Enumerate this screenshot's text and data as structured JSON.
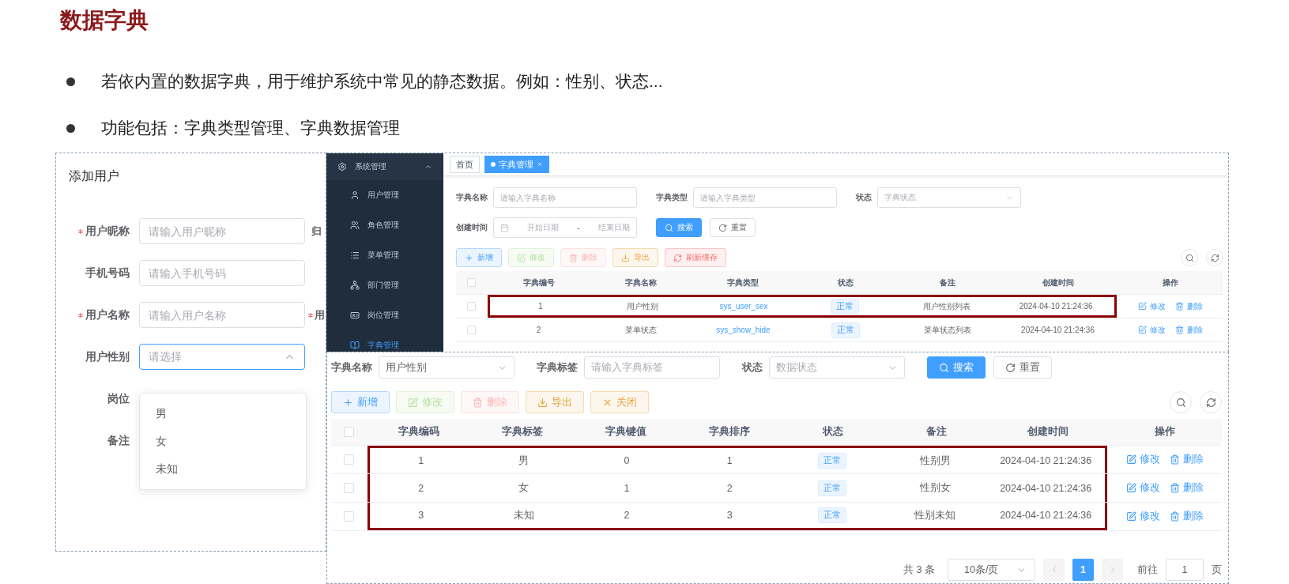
{
  "title": "数据字典",
  "bullets": [
    "若依内置的数据字典，用于维护系统中常见的静态数据。例如：性别、状态...",
    "功能包括：字典类型管理、字典数据管理"
  ],
  "add_user_form": {
    "title": "添加用户",
    "fields": [
      {
        "label": "用户昵称",
        "required": true,
        "kind": "input",
        "placeholder": "请输入用户昵称",
        "side_label": "归",
        "side_required": false
      },
      {
        "label": "手机号码",
        "required": false,
        "kind": "input",
        "placeholder": "请输入手机号码"
      },
      {
        "label": "用户名称",
        "required": true,
        "kind": "input",
        "placeholder": "请输入用户名称",
        "side_label": "用",
        "side_required": true
      },
      {
        "label": "用户性别",
        "required": false,
        "kind": "select",
        "placeholder": "请选择",
        "open": true,
        "options": [
          "男",
          "女",
          "未知"
        ]
      },
      {
        "label": "岗位",
        "required": false,
        "kind": "covered"
      },
      {
        "label": "备注",
        "required": false,
        "kind": "covered"
      }
    ]
  },
  "dict_type_screen": {
    "sidebar": {
      "group": {
        "label": "系统管理",
        "expanded": true
      },
      "items": [
        {
          "label": "用户管理",
          "selected": false
        },
        {
          "label": "角色管理",
          "selected": false
        },
        {
          "label": "菜单管理",
          "selected": false
        },
        {
          "label": "部门管理",
          "selected": false
        },
        {
          "label": "岗位管理",
          "selected": false
        },
        {
          "label": "字典管理",
          "selected": true
        }
      ]
    },
    "tabs": [
      {
        "label": "首页",
        "selected": false,
        "closable": false
      },
      {
        "label": "字典管理",
        "selected": true,
        "closable": true
      }
    ],
    "filters": [
      {
        "label": "字典名称",
        "kind": "input",
        "placeholder": "请输入字典名称"
      },
      {
        "label": "字典类型",
        "kind": "input",
        "placeholder": "请输入字典类型"
      },
      {
        "label": "状态",
        "kind": "select",
        "placeholder": "字典状态"
      },
      {
        "label": "创建时间",
        "kind": "daterange",
        "start_placeholder": "开始日期",
        "separator": "-",
        "end_placeholder": "结束日期"
      }
    ],
    "search_buttons": [
      {
        "label": "搜索",
        "kind": "primary"
      },
      {
        "label": "重置",
        "kind": "default"
      }
    ],
    "actions": [
      {
        "label": "新增",
        "kind": "add",
        "disabled": false
      },
      {
        "label": "修改",
        "kind": "edit",
        "disabled": true
      },
      {
        "label": "删除",
        "kind": "delete",
        "disabled": true
      },
      {
        "label": "导出",
        "kind": "export",
        "disabled": false
      },
      {
        "label": "刷新缓存",
        "kind": "refresh",
        "disabled": false
      }
    ],
    "table": {
      "all_checked": false,
      "columns": [
        {
          "label": "字典编号",
          "kind": "text"
        },
        {
          "label": "字典名称",
          "kind": "text"
        },
        {
          "label": "字典类型",
          "kind": "link"
        },
        {
          "label": "状态",
          "kind": "tag"
        },
        {
          "label": "备注",
          "kind": "text"
        },
        {
          "label": "创建时间",
          "kind": "text"
        }
      ],
      "ops_label": "操作",
      "rows": [
        {
          "cells": [
            "1",
            "用户性别",
            "sys_user_sex",
            "正常",
            "用户性别列表",
            "2024-04-10 21:24:36"
          ],
          "ops": [
            "修改",
            "删除"
          ],
          "checked": false,
          "highlighted": true
        },
        {
          "cells": [
            "2",
            "菜单状态",
            "sys_show_hide",
            "正常",
            "菜单状态列表",
            "2024-04-10 21:24:36"
          ],
          "ops": [
            "修改",
            "删除"
          ],
          "checked": false,
          "highlighted": false
        }
      ]
    }
  },
  "dict_data_screen": {
    "filters": [
      {
        "label": "字典名称",
        "kind": "select",
        "value": "用户性别"
      },
      {
        "label": "字典标签",
        "kind": "input",
        "placeholder": "请输入字典标签"
      },
      {
        "label": "状态",
        "kind": "select",
        "placeholder": "数据状态"
      }
    ],
    "search_buttons": [
      {
        "label": "搜索",
        "kind": "primary"
      },
      {
        "label": "重置",
        "kind": "default"
      }
    ],
    "actions": [
      {
        "label": "新增",
        "kind": "add",
        "disabled": false
      },
      {
        "label": "修改",
        "kind": "edit",
        "disabled": true
      },
      {
        "label": "删除",
        "kind": "delete",
        "disabled": true
      },
      {
        "label": "导出",
        "kind": "export",
        "disabled": false
      },
      {
        "label": "关闭",
        "kind": "close",
        "disabled": false
      }
    ],
    "table": {
      "all_checked": false,
      "columns": [
        {
          "label": "字典编码",
          "kind": "text"
        },
        {
          "label": "字典标签",
          "kind": "text"
        },
        {
          "label": "字典键值",
          "kind": "text"
        },
        {
          "label": "字典排序",
          "kind": "text"
        },
        {
          "label": "状态",
          "kind": "tag"
        },
        {
          "label": "备注",
          "kind": "text"
        },
        {
          "label": "创建时间",
          "kind": "text"
        }
      ],
      "ops_label": "操作",
      "rows": [
        {
          "cells": [
            "1",
            "男",
            "0",
            "1",
            "正常",
            "性别男",
            "2024-04-10 21:24:36"
          ],
          "ops": [
            "修改",
            "删除"
          ],
          "checked": false,
          "highlighted": true
        },
        {
          "cells": [
            "2",
            "女",
            "1",
            "2",
            "正常",
            "性别女",
            "2024-04-10 21:24:36"
          ],
          "ops": [
            "修改",
            "删除"
          ],
          "checked": false,
          "highlighted": true
        },
        {
          "cells": [
            "3",
            "未知",
            "2",
            "3",
            "正常",
            "性别未知",
            "2024-04-10 21:24:36"
          ],
          "ops": [
            "修改",
            "删除"
          ],
          "checked": false,
          "highlighted": true
        }
      ]
    },
    "pagination": {
      "total": "共 3 条",
      "page_size": "10条/页",
      "pages": [
        {
          "label": "1",
          "selected": true
        }
      ],
      "goto_label": "前往",
      "goto_value": "1",
      "page_suffix": "页"
    }
  }
}
